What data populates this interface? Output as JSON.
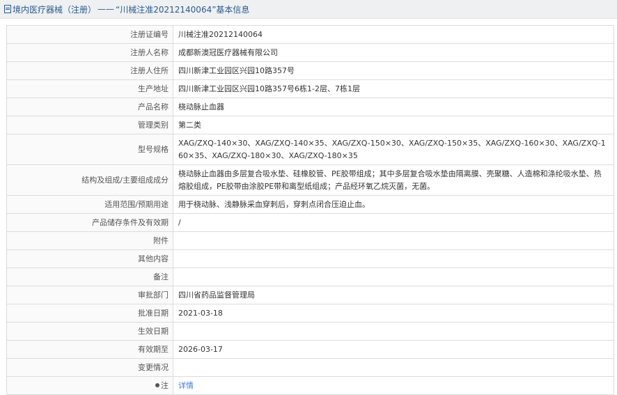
{
  "header": {
    "category": "境内医疗器械（注册）",
    "separator": "——",
    "title": "“川械注准20212140064”基本信息"
  },
  "rows": [
    {
      "label": "注册证编号",
      "value": "川械注准20212140064"
    },
    {
      "label": "注册人名称",
      "value": "成都新澳冠医疗器械有限公司"
    },
    {
      "label": "注册人住所",
      "value": "四川新津工业园区兴园10路357号"
    },
    {
      "label": "生产地址",
      "value": "四川新津工业园区兴园10路357号6栋1-2层、7栋1层"
    },
    {
      "label": "产品名称",
      "value": "桡动脉止血器"
    },
    {
      "label": "管理类别",
      "value": "第二类"
    },
    {
      "label": "型号规格",
      "value": "XAG/ZXQ-140×30、XAG/ZXQ-140×35、XAG/ZXQ-150×30、XAG/ZXQ-150×35、XAG/ZXQ-160×30、XAG/ZXQ-160×35、XAG/ZXQ-180×30、XAG/ZXQ-180×35"
    },
    {
      "label": "结构及组成/主要组成成分",
      "value": "桡动脉止血器由多层复合吸水垫、硅橡胶管、PE胶带组成；其中多层复合吸水垫由隔离膜、壳聚糖、人造棉和涤纶吸水垫、热熔胶组成，PE胶带由涂胶PE带和离型纸组成；产品经环氧乙烷灭菌，无菌。"
    },
    {
      "label": "适用范围/预期用途",
      "value": "用于桡动脉、浅静脉采血穿刺后，穿刺点闭合压迫止血。"
    },
    {
      "label": "产品储存条件及有效期",
      "value": "/"
    },
    {
      "label": "附件",
      "value": ""
    },
    {
      "label": "其他内容",
      "value": ""
    },
    {
      "label": "备注",
      "value": ""
    },
    {
      "label": "审批部门",
      "value": "四川省药品监督管理局"
    },
    {
      "label": "批准日期",
      "value": "2021-03-18"
    },
    {
      "label": "生效日期",
      "value": ""
    },
    {
      "label": "有效期至",
      "value": "2026-03-17"
    },
    {
      "label": "变更情况",
      "value": ""
    },
    {
      "label": "注",
      "value": "详情",
      "icon": "note-icon"
    }
  ],
  "colors": {
    "header_bg": "#eef0f2",
    "header_text": "#2c5a8c",
    "link": "#3a7bd5",
    "border": "#dcdcdc"
  }
}
